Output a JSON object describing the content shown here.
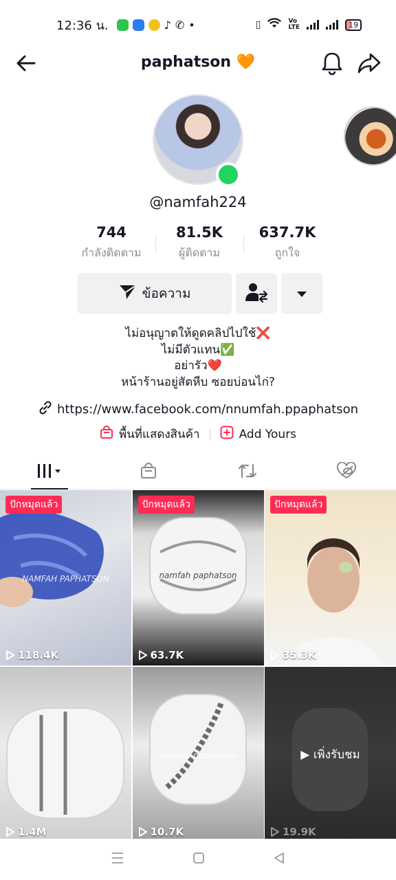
{
  "status_bar": {
    "time": "12:36 น.",
    "battery": "19"
  },
  "header": {
    "title": "paphatson 🧡"
  },
  "profile": {
    "username": "@namfah224",
    "stats": [
      {
        "value": "744",
        "label": "กำลังติดตาม"
      },
      {
        "value": "81.5K",
        "label": "ผู้ติดตาม"
      },
      {
        "value": "637.7K",
        "label": "ถูกใจ"
      }
    ],
    "message_label": "ข้อความ",
    "bio_lines": [
      "ไม่อนุญาตให้ดูดคลิปไปใช้❌",
      "ไม่มีตัวแทน✅",
      "อย่ารัว❤️",
      "หน้าร้านอยู่สัตหีบ ซอยบ่อนไก่?"
    ],
    "link": "https://www.facebook.com/nnumfah.ppaphatson",
    "showcase_label": "พื้นที่แสดงสินค้า",
    "add_yours_label": "Add Yours"
  },
  "videos": [
    {
      "badge": "ปักหมุดแล้ว",
      "views": "118.4K",
      "watermark": "NAMFAH PAPHATSON"
    },
    {
      "badge": "ปักหมุดแล้ว",
      "views": "63.7K",
      "watermark": "namfah paphatson"
    },
    {
      "badge": "ปักหมุดแล้ว",
      "views": "35.3K"
    },
    {
      "views": "1.4M"
    },
    {
      "views": "10.7K",
      "watermark": "namfah paphatson"
    },
    {
      "views": "19.9K",
      "overlay": "▶ เพิ่งรับชม"
    }
  ],
  "colors": {
    "accent": "#fe2c55",
    "online": "#20d55f",
    "button_bg": "#f1f1f2",
    "muted_text": "#8a8b91"
  }
}
